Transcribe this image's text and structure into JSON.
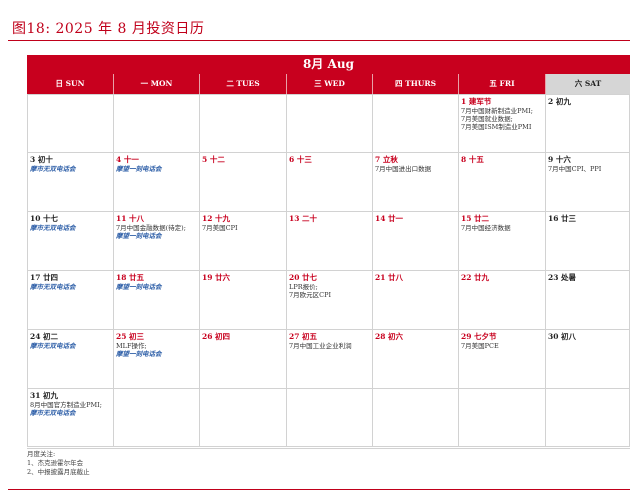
{
  "figure_title": "图18:  2025 年 8 月投资日历",
  "month": "8月 Aug",
  "weekdays": [
    "日 SUN",
    "一 MON",
    "二 TUES",
    "三 WED",
    "四 THURS",
    "五 FRI",
    "六 SAT"
  ],
  "weeks": [
    [
      null,
      null,
      null,
      null,
      null,
      {
        "day": "1 建军节",
        "lines": [
          "7月中国财新制造业PMI;",
          "7月美国就业数据;",
          "7月美国ISM制造业PMI"
        ],
        "links": [],
        "red": true
      },
      {
        "day": "2 初九",
        "lines": [],
        "links": [],
        "red": false
      }
    ],
    [
      {
        "day": "3 初十",
        "lines": [],
        "links": [
          "摩市无双电话会"
        ],
        "red": false
      },
      {
        "day": "4 十一",
        "lines": [],
        "links": [
          "摩望一刻电话会"
        ],
        "red": true
      },
      {
        "day": "5 十二",
        "lines": [],
        "links": [],
        "red": true
      },
      {
        "day": "6 十三",
        "lines": [],
        "links": [],
        "red": true
      },
      {
        "day": "7 立秋",
        "lines": [
          "7月中国进出口数据"
        ],
        "links": [],
        "red": true
      },
      {
        "day": "8 十五",
        "lines": [],
        "links": [],
        "red": true
      },
      {
        "day": "9 十六",
        "lines": [
          "7月中国CPI、PPI"
        ],
        "links": [],
        "red": false
      }
    ],
    [
      {
        "day": "10 十七",
        "lines": [],
        "links": [
          "摩市无双电话会"
        ],
        "red": false
      },
      {
        "day": "11 十八",
        "lines": [
          "7月中国金融数据(待定);"
        ],
        "links": [
          "摩望一刻电话会"
        ],
        "red": true
      },
      {
        "day": "12 十九",
        "lines": [
          "7月美国CPI"
        ],
        "links": [],
        "red": true
      },
      {
        "day": "13 二十",
        "lines": [],
        "links": [],
        "red": true
      },
      {
        "day": "14 廿一",
        "lines": [],
        "links": [],
        "red": true
      },
      {
        "day": "15 廿二",
        "lines": [
          "7月中国经济数据"
        ],
        "links": [],
        "red": true
      },
      {
        "day": "16 廿三",
        "lines": [],
        "links": [],
        "red": false
      }
    ],
    [
      {
        "day": "17 廿四",
        "lines": [],
        "links": [
          "摩市无双电话会"
        ],
        "red": false
      },
      {
        "day": "18 廿五",
        "lines": [],
        "links": [
          "摩望一刻电话会"
        ],
        "red": true
      },
      {
        "day": "19 廿六",
        "lines": [],
        "links": [],
        "red": true
      },
      {
        "day": "20 廿七",
        "lines": [
          "LPR报价;",
          "7月欧元区CPI"
        ],
        "links": [],
        "red": true
      },
      {
        "day": "21 廿八",
        "lines": [],
        "links": [],
        "red": true
      },
      {
        "day": "22 廿九",
        "lines": [],
        "links": [],
        "red": true
      },
      {
        "day": "23 处暑",
        "lines": [],
        "links": [],
        "red": false
      }
    ],
    [
      {
        "day": "24 初二",
        "lines": [],
        "links": [
          "摩市无双电话会"
        ],
        "red": false
      },
      {
        "day": "25 初三",
        "lines": [
          "MLF操作;"
        ],
        "links": [
          "摩望一刻电话会"
        ],
        "red": true
      },
      {
        "day": "26 初四",
        "lines": [],
        "links": [],
        "red": true
      },
      {
        "day": "27 初五",
        "lines": [
          "7月中国工业企业利润"
        ],
        "links": [],
        "red": true
      },
      {
        "day": "28 初六",
        "lines": [],
        "links": [],
        "red": true
      },
      {
        "day": "29 七夕节",
        "lines": [
          "7月美国PCE"
        ],
        "links": [],
        "red": true
      },
      {
        "day": "30 初八",
        "lines": [],
        "links": [],
        "red": false
      }
    ],
    [
      {
        "day": "31 初九",
        "lines": [
          "8月中国官方制造业PMI;"
        ],
        "links": [
          "摩市无双电话会"
        ],
        "red": false
      },
      null,
      null,
      null,
      null,
      null,
      null
    ]
  ],
  "footnote": {
    "heading": "月度关注:",
    "items": [
      "1、杰克逊霍尔年会",
      "2、中报披露月底截止"
    ]
  }
}
